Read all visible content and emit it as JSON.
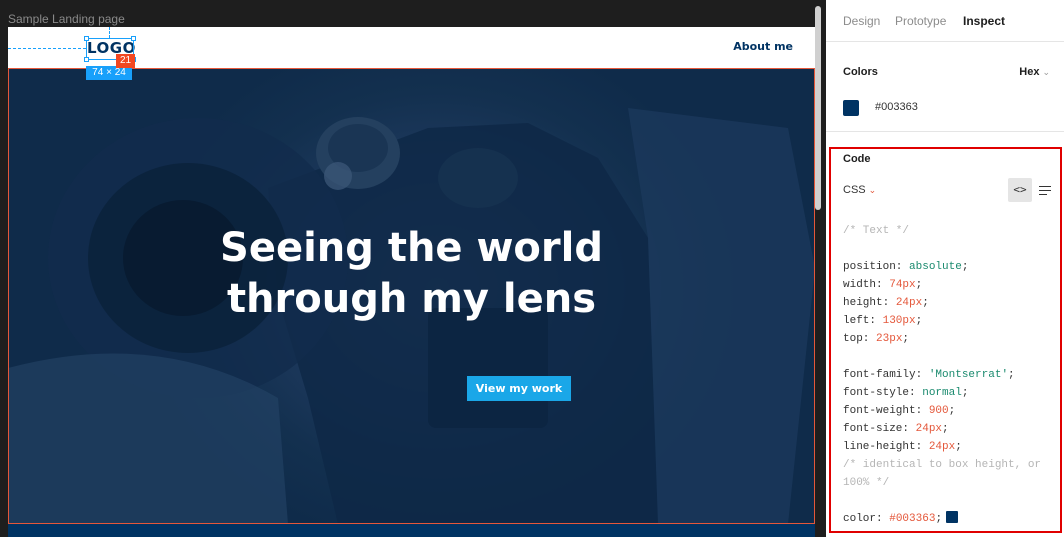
{
  "canvas": {
    "frame_label": "Sample Landing page",
    "size_badge": "74 × 24",
    "distance_badge": "21"
  },
  "site": {
    "logo": "LOGO",
    "nav_link": "About me",
    "hero_title_line1": "Seeing the world",
    "hero_title_line2": "through my lens",
    "cta_label": "View my work"
  },
  "panel": {
    "tabs": [
      {
        "label": "Design",
        "active": false
      },
      {
        "label": "Prototype",
        "active": false
      },
      {
        "label": "Inspect",
        "active": true
      }
    ],
    "colors": {
      "title": "Colors",
      "format": "Hex",
      "swatch_color": "#003363",
      "value": "#003363"
    },
    "code": {
      "title": "Code",
      "language": "CSS",
      "view_icon": "code-brackets-icon",
      "wrap_icon": "text-wrap-icon",
      "comment_text": "/* Text */",
      "position_prop": "position: ",
      "position_val": "absolute",
      "width_prop": "width: ",
      "width_val": "74px",
      "height_prop": "height: ",
      "height_val": "24px",
      "left_prop": "left: ",
      "left_val": "130px",
      "top_prop": "top: ",
      "top_val": "23px",
      "font_family_prop": "font-family: ",
      "font_family_val": "'Montserrat'",
      "font_style_prop": "font-style: ",
      "font_style_val": "normal",
      "font_weight_prop": "font-weight: ",
      "font_weight_val": "900",
      "font_size_prop": "font-size: ",
      "font_size_val": "24px",
      "line_height_prop": "line-height: ",
      "line_height_val": "24px",
      "comment_identical_1": "/* identical to box height, or",
      "comment_identical_2": "100% */",
      "color_prop": "color: ",
      "color_val": "#003363",
      "semicolon": ";"
    }
  },
  "colors": {
    "brand_navy": "#003363",
    "cta_blue": "#1aa7e8",
    "selection_blue": "#18a0fb",
    "highlight_red": "#e00000"
  }
}
